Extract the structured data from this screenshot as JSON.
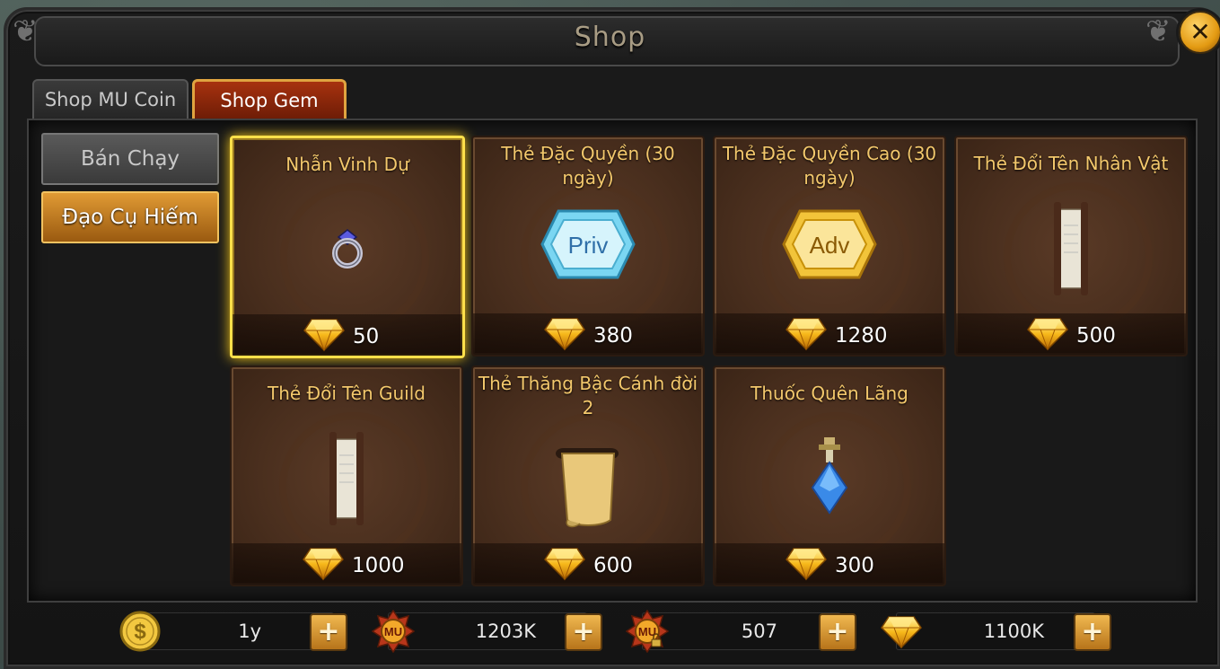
{
  "window": {
    "title": "Shop"
  },
  "tabs": [
    {
      "label": "Shop MU Coin",
      "active": false
    },
    {
      "label": "Shop Gem",
      "active": true
    }
  ],
  "sidebar": {
    "items": [
      {
        "label": "Bán Chạy",
        "active": false
      },
      {
        "label": "Đạo Cụ Hiếm",
        "active": true
      }
    ]
  },
  "items": [
    {
      "name": "Nhẫn Vinh Dự",
      "price": "50",
      "icon": "ring-icon",
      "selected": true
    },
    {
      "name": "Thẻ Đặc Quyền (30 ngày)",
      "price": "380",
      "icon": "priv-card-icon",
      "icon_text": "Priv"
    },
    {
      "name": "Thẻ Đặc Quyền Cao (30 ngày)",
      "price": "1280",
      "icon": "adv-card-icon",
      "icon_text": "Adv"
    },
    {
      "name": "Thẻ Đổi Tên Nhân Vật",
      "price": "500",
      "icon": "scroll-icon"
    },
    {
      "name": "Thẻ Đổi Tên Guild",
      "price": "1000",
      "icon": "scroll-icon"
    },
    {
      "name": "Thẻ Thăng Bậc Cánh đời 2",
      "price": "600",
      "icon": "parchment-icon"
    },
    {
      "name": "Thuốc Quên Lãng",
      "price": "300",
      "icon": "potion-icon"
    }
  ],
  "currency": {
    "zen": {
      "value": "1y",
      "icon": "dollar-coin-icon"
    },
    "mu_coin": {
      "value": "1203K",
      "icon": "mu-coin-icon",
      "icon_text": "MU"
    },
    "mu_coin_locked": {
      "value": "507",
      "icon": "mu-coin-locked-icon",
      "icon_text": "MU"
    },
    "gem": {
      "value": "1100K",
      "icon": "gem-icon"
    }
  },
  "colors": {
    "accent": "#f3c86c",
    "tab_active": "#a7320f",
    "selected_glow": "#ffe04a",
    "button": "#e09a34"
  }
}
